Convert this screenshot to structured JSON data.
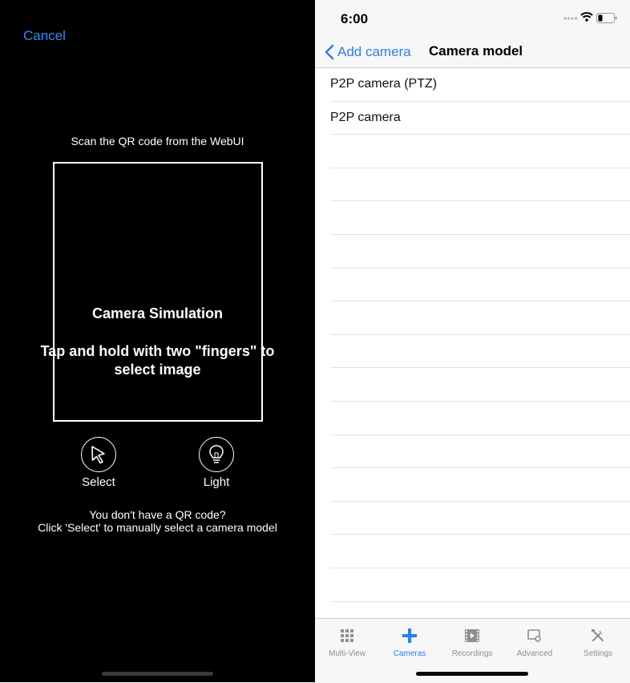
{
  "scanner": {
    "cancel_label": "Cancel",
    "scan_instruction": "Scan the QR code from the WebUI",
    "simulation_title": "Camera Simulation",
    "simulation_message": "Tap and hold with two \"fingers\" to select image",
    "select_label": "Select",
    "light_label": "Light",
    "help_line1": "You don't have a QR code?",
    "help_line2": "Click 'Select' to manually select a camera model"
  },
  "status_bar": {
    "time": "6:00"
  },
  "nav": {
    "back_label": "Add camera",
    "title": "Camera model"
  },
  "camera_models": [
    {
      "label": "P2P camera (PTZ)"
    },
    {
      "label": "P2P camera"
    }
  ],
  "tabs": [
    {
      "label": "Multi-View",
      "icon": "grid-icon",
      "active": false
    },
    {
      "label": "Cameras",
      "icon": "plus-icon",
      "active": true
    },
    {
      "label": "Recordings",
      "icon": "film-icon",
      "active": false
    },
    {
      "label": "Advanced",
      "icon": "advanced-icon",
      "active": false
    },
    {
      "label": "Settings",
      "icon": "tools-icon",
      "active": false
    }
  ],
  "colors": {
    "accent": "#2f7ef2",
    "left_background": "#000000",
    "inactive_tab": "#8e8e93"
  }
}
